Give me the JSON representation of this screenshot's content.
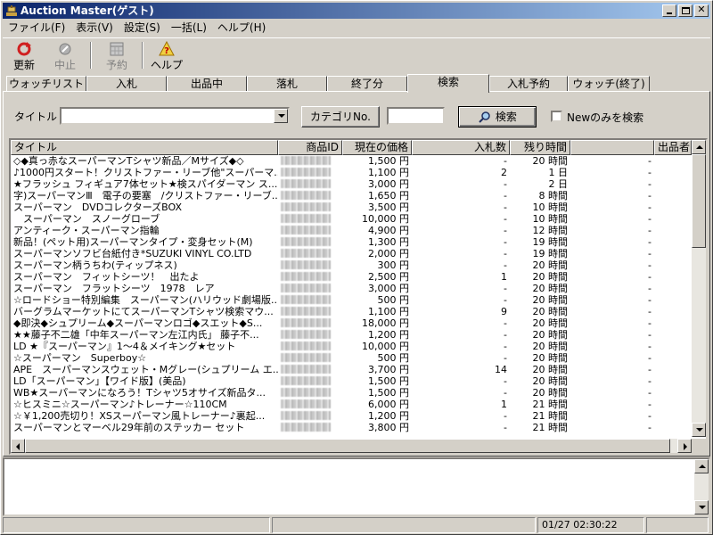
{
  "window": {
    "title": "Auction Master(ゲスト)"
  },
  "menu": [
    "ファイル(F)",
    "表示(V)",
    "設定(S)",
    "一括(L)",
    "ヘルプ(H)"
  ],
  "toolbar": {
    "refresh": "更新",
    "stop": "中止",
    "reserve": "予約",
    "help": "ヘルプ"
  },
  "tabs": [
    "ウォッチリスト",
    "入札",
    "出品中",
    "落札",
    "終了分",
    "検索",
    "入札予約",
    "ウォッチ(終了)"
  ],
  "active_tab": "検索",
  "search": {
    "title_label": "タイトル",
    "title_value": "",
    "category_button": "カテゴリNo.",
    "category_value": "",
    "search_button": "検索",
    "new_only_label": "Newのみを検索"
  },
  "columns": {
    "title": "タイトル",
    "id": "商品ID",
    "price": "現在の価格",
    "bids": "入札数",
    "time": "残り時間",
    "blank": "",
    "seller": "出品者"
  },
  "rows": [
    {
      "title": "◇◆真っ赤なスーパーマンTシャツ新品／Mサイズ◆◇",
      "price": "1,500 円",
      "bids": "-",
      "time": "20 時間",
      "blank": "-"
    },
    {
      "title": "♪1000円スタート！クリストファー・リーブ他\"スーパーマ...",
      "price": "1,100 円",
      "bids": "2",
      "time": "1 日",
      "blank": "-"
    },
    {
      "title": "★フラッシュ フィギュア7体セット★検スパイダーマン ス...",
      "price": "3,000 円",
      "bids": "-",
      "time": "2 日",
      "blank": "-"
    },
    {
      "title": "字)スーパーマンⅢ　電子の要塞　/クリストファー・リーブ...",
      "price": "1,650 円",
      "bids": "-",
      "time": "8 時間",
      "blank": "-"
    },
    {
      "title": "スーパーマン　DVDコレクターズBOX",
      "price": "3,500 円",
      "bids": "-",
      "time": "10 時間",
      "blank": "-"
    },
    {
      "title": "　スーパーマン　スノーグローブ",
      "price": "10,000 円",
      "bids": "-",
      "time": "10 時間",
      "blank": "-"
    },
    {
      "title": "アンティーク・スーパーマン指輪",
      "price": "4,900 円",
      "bids": "-",
      "time": "12 時間",
      "blank": "-"
    },
    {
      "title": "新品！(ペット用)スーパーマンタイプ・変身セット(M)",
      "price": "1,300 円",
      "bids": "-",
      "time": "19 時間",
      "blank": "-"
    },
    {
      "title": "スーパーマンソフビ台紙付き*SUZUKI VINYL CO.LTD",
      "price": "2,000 円",
      "bids": "-",
      "time": "19 時間",
      "blank": "-"
    },
    {
      "title": "スーパーマン柄うちわ(ティップネス)",
      "price": "300 円",
      "bids": "-",
      "time": "20 時間",
      "blank": "-"
    },
    {
      "title": "スーパーマン　フィットシーツ！　出たよ",
      "price": "2,500 円",
      "bids": "1",
      "time": "20 時間",
      "blank": "-"
    },
    {
      "title": "スーパーマン　フラットシーツ　1978　レア",
      "price": "3,000 円",
      "bids": "-",
      "time": "20 時間",
      "blank": "-"
    },
    {
      "title": "☆ロードショー特別編集　スーパーマン(ハリウッド劇場版...",
      "price": "500 円",
      "bids": "-",
      "time": "20 時間",
      "blank": "-"
    },
    {
      "title": "バーグラムマーケットにてスーパーマンTシャツ検索マウ...",
      "price": "1,100 円",
      "bids": "9",
      "time": "20 時間",
      "blank": "-"
    },
    {
      "title": "◆即決◆シュプリーム◆スーパーマンロゴ◆スエット◆S...",
      "price": "18,000 円",
      "bids": "-",
      "time": "20 時間",
      "blank": "-"
    },
    {
      "title": "★★藤子不二雄「中年スーパーマン左江内氏」 藤子不...",
      "price": "1,200 円",
      "bids": "-",
      "time": "20 時間",
      "blank": "-"
    },
    {
      "title": "LD ★『スーパーマン』1～4＆メイキング★セット",
      "price": "10,000 円",
      "bids": "-",
      "time": "20 時間",
      "blank": "-"
    },
    {
      "title": "☆スーパーマン　Superboy☆",
      "price": "500 円",
      "bids": "-",
      "time": "20 時間",
      "blank": "-"
    },
    {
      "title": "APE　スーパーマンスウェット・Mグレー(シュプリーム エ...",
      "price": "3,700 円",
      "bids": "14",
      "time": "20 時間",
      "blank": "-"
    },
    {
      "title": "LD「スーパーマン」【ワイド版】(美品)",
      "price": "1,500 円",
      "bids": "-",
      "time": "20 時間",
      "blank": "-"
    },
    {
      "title": "WB★スーパーマンになろう！Tシャツ5オサイズ新品タ...",
      "price": "1,500 円",
      "bids": "-",
      "time": "20 時間",
      "blank": "-"
    },
    {
      "title": "☆ヒスミニ☆スーパーマン♪トレーナー☆110CM",
      "price": "6,000 円",
      "bids": "1",
      "time": "21 時間",
      "blank": "-"
    },
    {
      "title": "☆￥1,200売切り！XSスーパーマン風トレーナー♪裏起...",
      "price": "1,200 円",
      "bids": "-",
      "time": "21 時間",
      "blank": "-"
    },
    {
      "title": "スーパーマンとマーベル29年前のステッカー セット",
      "price": "3,800 円",
      "bids": "-",
      "time": "21 時間",
      "blank": "-"
    }
  ],
  "status": {
    "datetime": "01/27 02:30:22"
  }
}
